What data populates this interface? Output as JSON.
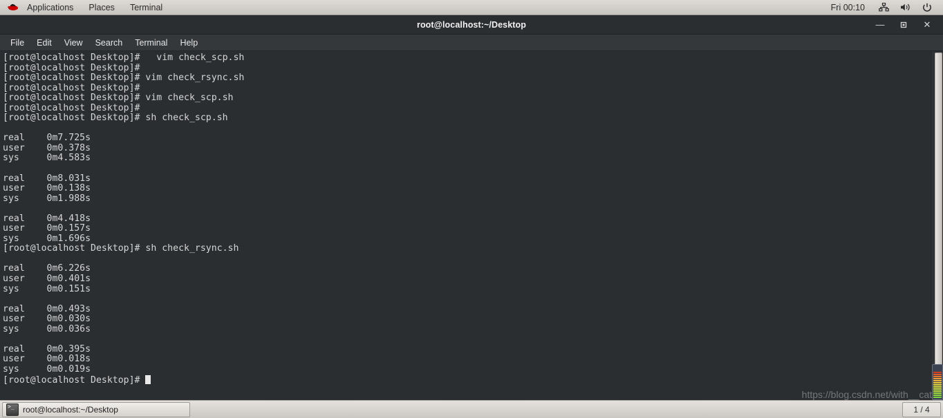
{
  "top_panel": {
    "logo_icon": "redhat-logo-icon",
    "menus": [
      {
        "label": "Applications"
      },
      {
        "label": "Places"
      },
      {
        "label": "Terminal"
      }
    ],
    "clock": "Fri 00:10",
    "tray": [
      {
        "icon": "network-icon"
      },
      {
        "icon": "volume-icon"
      },
      {
        "icon": "power-icon"
      }
    ]
  },
  "window": {
    "title": "root@localhost:~/Desktop",
    "controls": {
      "minimize": "—",
      "maximize": "■",
      "close": "✕"
    },
    "menubar": [
      {
        "label": "File"
      },
      {
        "label": "Edit"
      },
      {
        "label": "View"
      },
      {
        "label": "Search"
      },
      {
        "label": "Terminal"
      },
      {
        "label": "Help"
      }
    ]
  },
  "terminal": {
    "prompt": "[root@localhost Desktop]#",
    "colors": {
      "background": "#2b2e31",
      "foreground": "#d6d6d6",
      "cursor": "#e9e9e9"
    },
    "content": "[root@localhost Desktop]#   vim check_scp.sh\n[root@localhost Desktop]#\n[root@localhost Desktop]# vim check_rsync.sh\n[root@localhost Desktop]#\n[root@localhost Desktop]# vim check_scp.sh\n[root@localhost Desktop]#\n[root@localhost Desktop]# sh check_scp.sh\n\nreal    0m7.725s\nuser    0m0.378s\nsys     0m4.583s\n\nreal    0m8.031s\nuser    0m0.138s\nsys     0m1.988s\n\nreal    0m4.418s\nuser    0m0.157s\nsys     0m1.696s\n[root@localhost Desktop]# sh check_rsync.sh\n\nreal    0m6.226s\nuser    0m0.401s\nsys     0m0.151s\n\nreal    0m0.493s\nuser    0m0.030s\nsys     0m0.036s\n\nreal    0m0.395s\nuser    0m0.018s\nsys     0m0.019s\n",
    "last_prompt": "[root@localhost Desktop]# ",
    "commands": [
      "vim check_scp.sh",
      "vim check_rsync.sh",
      "vim check_scp.sh",
      "sh check_scp.sh",
      "sh check_rsync.sh"
    ],
    "timings": [
      {
        "real": "0m7.725s",
        "user": "0m0.378s",
        "sys": "0m4.583s"
      },
      {
        "real": "0m8.031s",
        "user": "0m0.138s",
        "sys": "0m1.988s"
      },
      {
        "real": "0m4.418s",
        "user": "0m0.157s",
        "sys": "0m1.696s"
      },
      {
        "real": "0m6.226s",
        "user": "0m0.401s",
        "sys": "0m0.151s"
      },
      {
        "real": "0m0.493s",
        "user": "0m0.030s",
        "sys": "0m0.036s"
      },
      {
        "real": "0m0.395s",
        "user": "0m0.018s",
        "sys": "0m0.019s"
      }
    ]
  },
  "taskbar": {
    "task_label": "root@localhost:~/Desktop",
    "task_icon": "terminal-icon",
    "workspace": "1 / 4"
  },
  "watermark": "https://blog.csdn.net/with__cat"
}
